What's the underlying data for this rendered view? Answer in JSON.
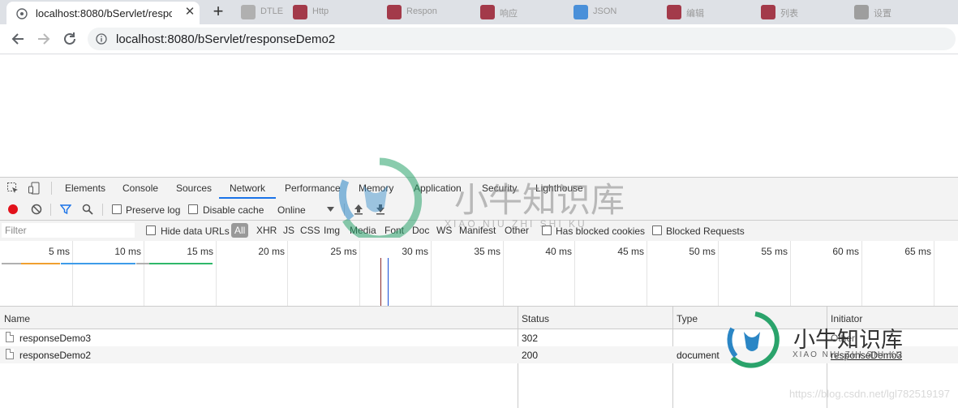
{
  "browser": {
    "active_tab": {
      "title": "localhost:8080/bServlet/respo",
      "close_label": "✕"
    },
    "new_tab_label": "+",
    "background_tabs": [
      {
        "label": "DTLE",
        "color": "#b0b0b0"
      },
      {
        "label": "Http",
        "color": "#a33a4a"
      },
      {
        "label": "Respon",
        "color": "#a33a4a"
      },
      {
        "label": "响应",
        "color": "#a33a4a"
      },
      {
        "label": "JSON",
        "color": "#4a90d9"
      },
      {
        "label": "编辑",
        "color": "#a33a4a"
      },
      {
        "label": "列表",
        "color": "#a33a4a"
      },
      {
        "label": "设置",
        "color": "#9e9e9e"
      }
    ],
    "url": "localhost:8080/bServlet/responseDemo2"
  },
  "devtools": {
    "tabs": [
      "Elements",
      "Console",
      "Sources",
      "Network",
      "Performance",
      "Memory",
      "Application",
      "Security",
      "Lighthouse"
    ],
    "active_tab": "Network",
    "toolbar": {
      "preserve_log": "Preserve log",
      "disable_cache": "Disable cache",
      "throttle": "Online"
    },
    "filter": {
      "placeholder": "Filter",
      "hide_data_urls": "Hide data URLs",
      "all": "All",
      "types": [
        "XHR",
        "JS",
        "CSS",
        "Img",
        "Media",
        "Font",
        "Doc",
        "WS",
        "Manifest",
        "Other"
      ],
      "has_blocked_cookies": "Has blocked cookies",
      "blocked_requests": "Blocked Requests"
    },
    "timeline_ticks": [
      "5 ms",
      "10 ms",
      "15 ms",
      "20 ms",
      "25 ms",
      "30 ms",
      "35 ms",
      "40 ms",
      "45 ms",
      "50 ms",
      "55 ms",
      "60 ms",
      "65 ms"
    ],
    "table": {
      "headers": {
        "name": "Name",
        "status": "Status",
        "type": "Type",
        "initiator": "Initiator"
      },
      "rows": [
        {
          "name": "responseDemo3",
          "status": "302",
          "type": "",
          "initiator": "Other"
        },
        {
          "name": "responseDemo2",
          "status": "200",
          "type": "document",
          "initiator": "responseDemo3"
        }
      ]
    }
  },
  "watermarks": {
    "brand_cn": "小牛知识库",
    "brand_en": "XIAO NIU ZHI SHI KU",
    "csdn": "https://blog.csdn.net/lgl782519197"
  },
  "colors": {
    "accent": "#1a73e8",
    "record": "#e2121b",
    "watermark_green": "#2aa36b",
    "watermark_blue": "#2b86c5"
  }
}
